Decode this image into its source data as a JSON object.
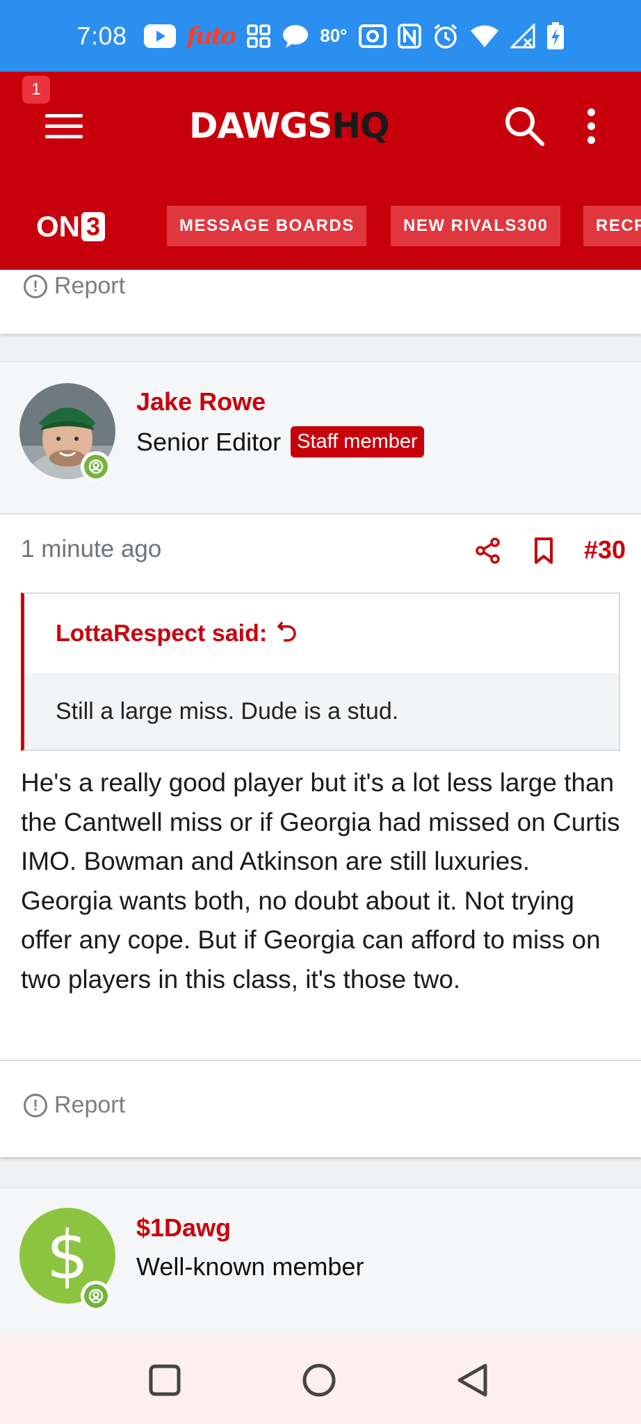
{
  "status_bar": {
    "time": "7:08",
    "futo_label": "futo",
    "temperature": "80°",
    "icons": [
      "youtube-icon",
      "futo-icon",
      "apps-grid-icon",
      "chat-bubble-icon",
      "temperature",
      "cast-icon",
      "nfc-icon",
      "alarm-icon",
      "wifi-icon",
      "signal-icon",
      "battery-charging-icon"
    ]
  },
  "header": {
    "notification_count": "1",
    "logo_part1": "DAWGS",
    "logo_part2": "HQ",
    "brand": "ON3",
    "brand_on": "ON",
    "brand_three": "3",
    "tabs": [
      {
        "label": "MESSAGE BOARDS"
      },
      {
        "label": "NEW RIVALS300"
      },
      {
        "label": "RECR"
      }
    ]
  },
  "previous_post": {
    "report_label": "Report"
  },
  "post": {
    "author": "Jake Rowe",
    "title": "Senior Editor",
    "badge": "Staff member",
    "timestamp": "1 minute ago",
    "number": "#30",
    "quote": {
      "author_label": "LottaRespect said:",
      "text": "Still a large miss. Dude is a stud."
    },
    "body": "He's a really good player but it's a lot less large than the Cantwell miss or if Georgia had missed on Curtis IMO. Bowman and Atkinson are still luxuries. Georgia wants both, no doubt about it. Not trying offer any cope. But if Georgia can afford to miss on two players in this class, it's those two.",
    "report_label": "Report"
  },
  "next_post": {
    "author": "$1Dawg",
    "title": "Well-known member",
    "avatar_letter": "$"
  },
  "colors": {
    "brand_red": "#c8000c",
    "status_blue": "#2b8ff0",
    "online_green": "#73b43c"
  }
}
